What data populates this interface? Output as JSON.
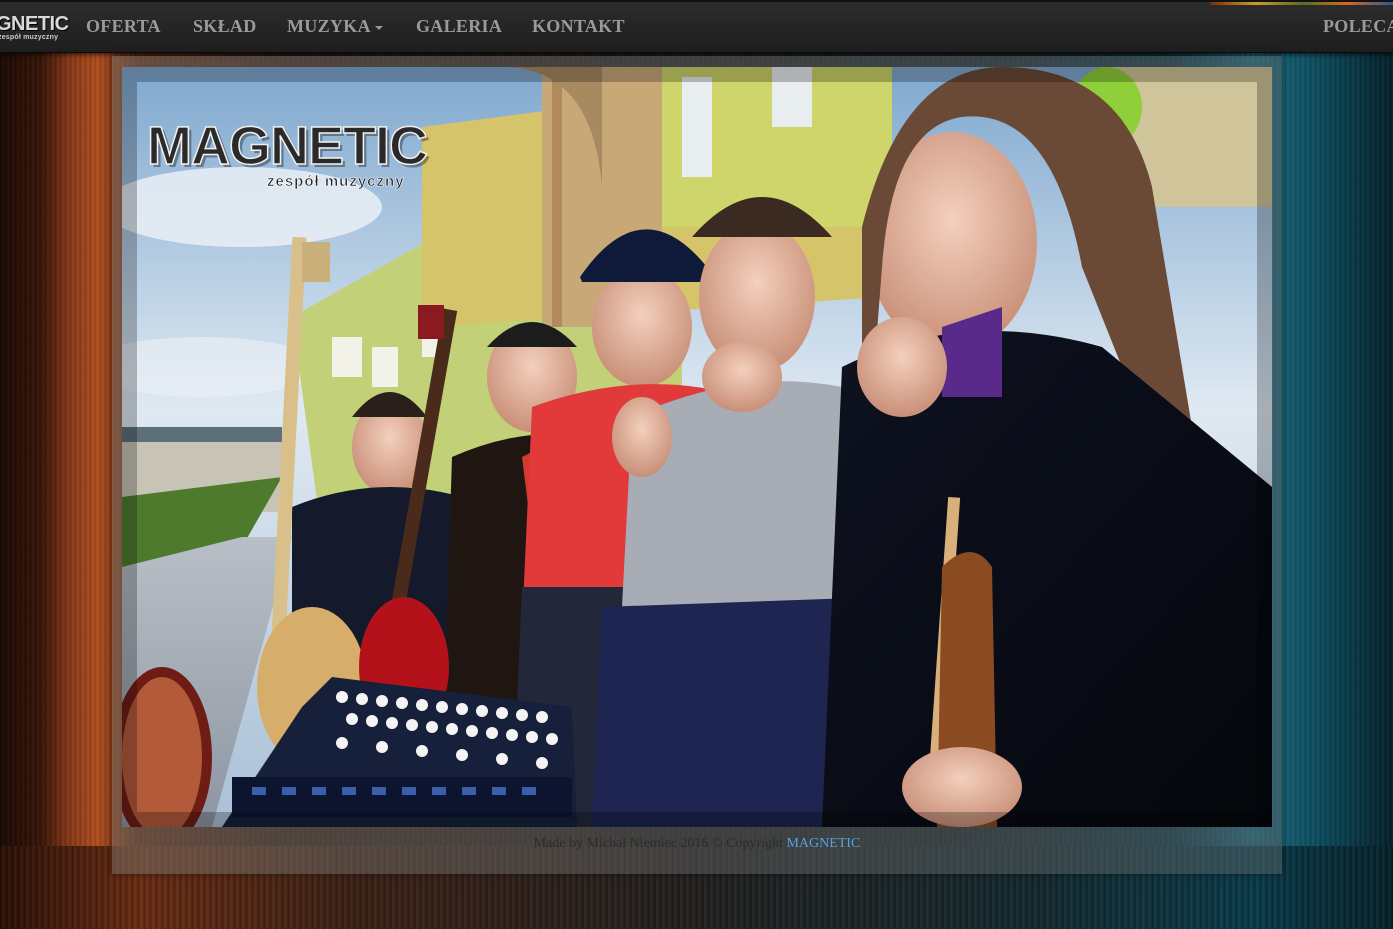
{
  "navbar": {
    "brand": {
      "name": "MAGNETIC",
      "name_display": "GNETIC",
      "subtitle": "zespół muzyczny"
    },
    "items": [
      {
        "label": "OFERTA"
      },
      {
        "label": "SKŁAD"
      },
      {
        "label": "MUZYKA",
        "has_dropdown": true
      },
      {
        "label": "GALERIA"
      },
      {
        "label": "KONTAKT"
      }
    ],
    "right_item": {
      "label": "POLECA"
    }
  },
  "hero": {
    "logo_text": "MAGNETIC",
    "logo_subtitle": "zespół muzyczny"
  },
  "footer": {
    "text": "Made by Michał Niemiec 2016 © Copyright",
    "link_text": "MAGNETIC"
  },
  "colors": {
    "navbar_bg": "#222222",
    "nav_text": "#9a9a9a",
    "footer_link": "#5aa0e0",
    "footer_text": "#2b2b2b"
  }
}
